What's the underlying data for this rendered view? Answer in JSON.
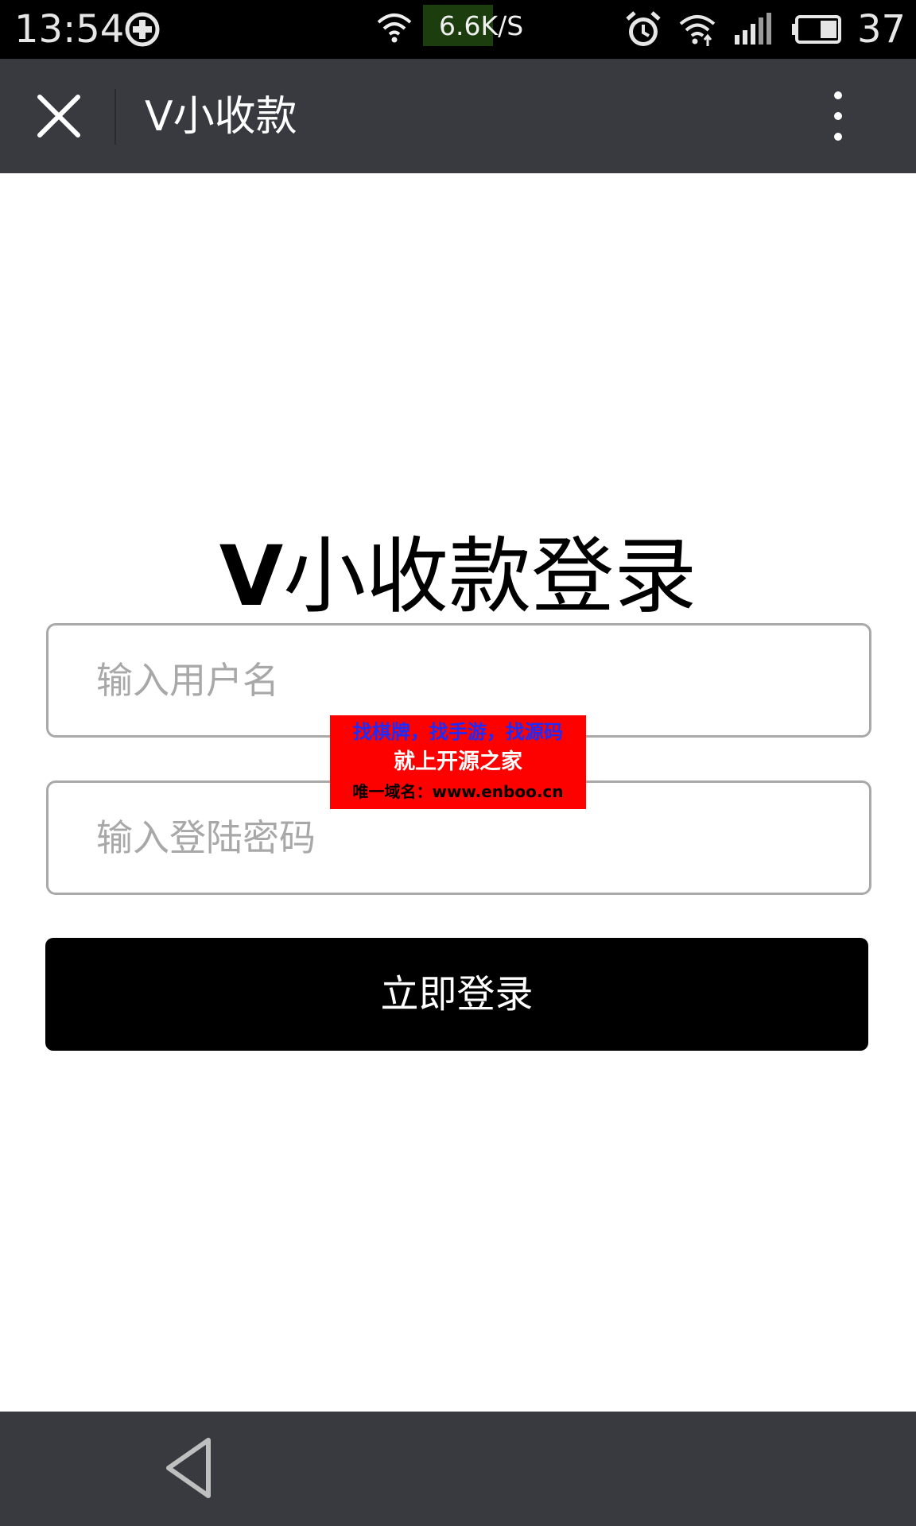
{
  "status_bar": {
    "time": "13:54",
    "network_speed": "6.6K/S",
    "battery": "37",
    "icons": [
      "sync-icon",
      "wifi-icon",
      "alarm-icon",
      "wifi-icon",
      "signal-4g-icon",
      "battery-icon"
    ]
  },
  "title_bar": {
    "title": "V小收款",
    "close_icon": "close-icon",
    "more_icon": "more-vertical-icon"
  },
  "login": {
    "title_brand": "V",
    "title_rest": "小收款登录",
    "username_placeholder": "输入用户名",
    "password_placeholder": "输入登陆密码",
    "submit_label": "立即登录"
  },
  "watermark": {
    "line1": "找棋牌，找手游，找源码",
    "line2": "就上开源之家",
    "line3": "唯一域名：www.enboo.cn"
  },
  "nav_bar": {
    "back_icon": "back-triangle-icon"
  },
  "colors": {
    "status_bar_bg": "#000000",
    "title_bar_bg": "#393a3f",
    "button_bg": "#000000",
    "input_border": "#a9a9a9",
    "placeholder": "#a8a8a8",
    "watermark_bg": "#fd0000",
    "watermark_line1": "#1a2cff",
    "speed_badge_bg": "#1c3d0e"
  }
}
